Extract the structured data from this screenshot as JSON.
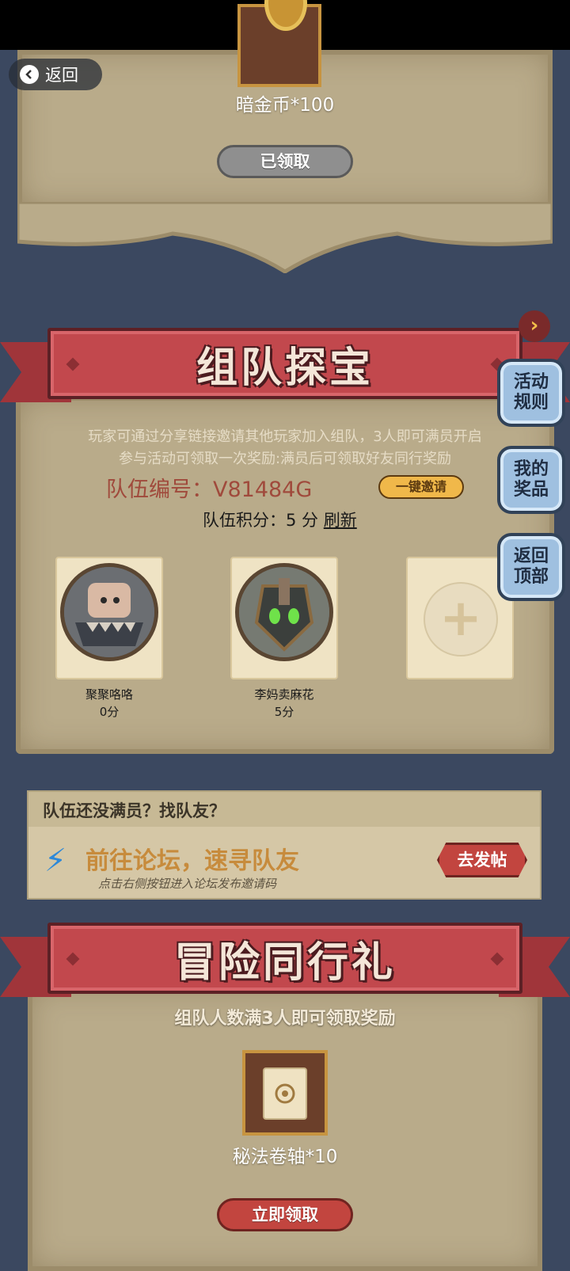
{
  "nav": {
    "back_label": "返回"
  },
  "top_reward": {
    "name": "暗金币*100",
    "button": "已领取"
  },
  "team_section": {
    "title": "组队探宝",
    "desc_line1": "玩家可通过分享链接邀请其他玩家加入组队，3人即可满员开启",
    "desc_line2": "参与活动可领取一次奖励:满员后可领取好友同行奖励",
    "team_id": "队伍编号：V81484G",
    "invite_button": "一键邀请",
    "score_label": "队伍积分：5 分",
    "refresh_label": "刷新",
    "members": [
      {
        "name": "聚聚咯咯",
        "score": "0分"
      },
      {
        "name": "李妈卖麻花",
        "score": "5分"
      }
    ]
  },
  "side_buttons": [
    "活动规则",
    "我的奖品",
    "返回顶部"
  ],
  "find_team": {
    "header": "队伍还没满员？找队友？",
    "main": "前往论坛，速寻队友",
    "sub": "点击右侧按钮进入论坛发布邀请码",
    "button": "去发帖"
  },
  "companion_section": {
    "title": "冒险同行礼",
    "threshold": "组队人数满3人即可领取奖励",
    "reward_name": "秘法卷轴*10",
    "button": "立即领取"
  },
  "colors": {
    "background": "#3b4860",
    "parchment": "#b9ab8a",
    "banner": "#c2484d",
    "accent_red": "#c2453f",
    "side_button": "#9fc0e0"
  }
}
